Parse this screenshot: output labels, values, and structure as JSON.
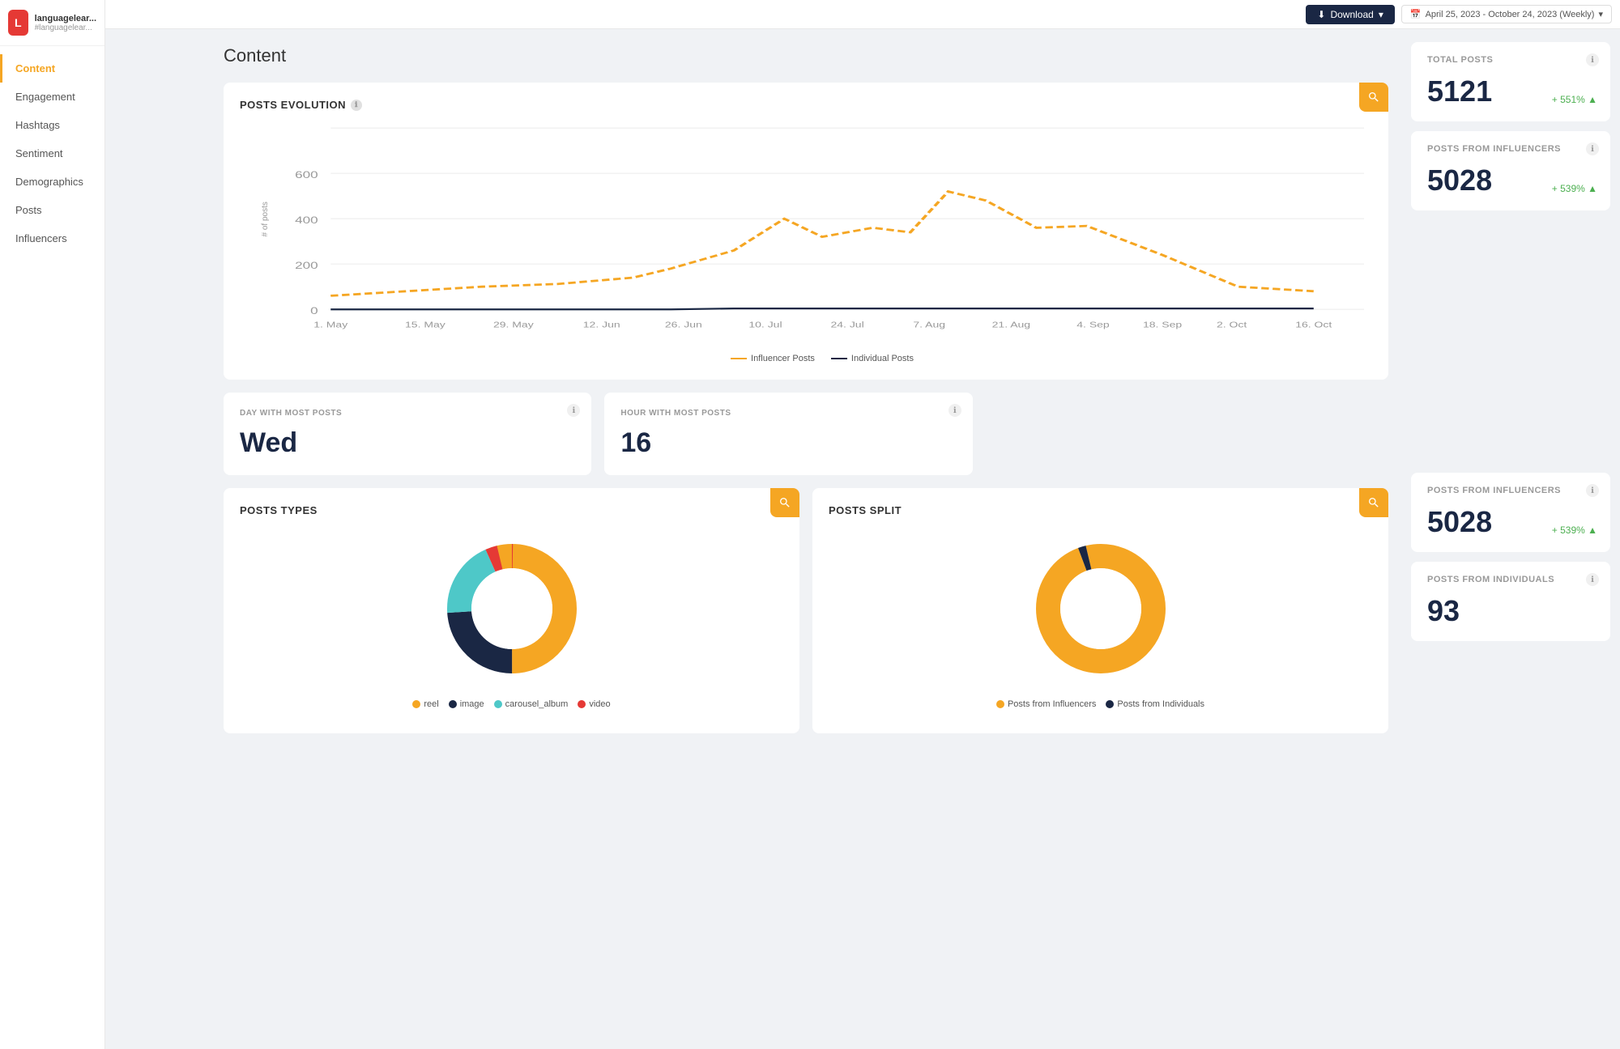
{
  "app": {
    "logo_letter": "L",
    "logo_name": "languagelear...",
    "logo_handle": "#languagelear..."
  },
  "nav": {
    "items": [
      {
        "label": "Content",
        "active": true,
        "id": "content"
      },
      {
        "label": "Engagement",
        "active": false,
        "id": "engagement"
      },
      {
        "label": "Hashtags",
        "active": false,
        "id": "hashtags"
      },
      {
        "label": "Sentiment",
        "active": false,
        "id": "sentiment"
      },
      {
        "label": "Demographics",
        "active": false,
        "id": "demographics"
      },
      {
        "label": "Posts",
        "active": false,
        "id": "posts"
      },
      {
        "label": "Influencers",
        "active": false,
        "id": "influencers"
      }
    ]
  },
  "topbar": {
    "download_label": "Download",
    "date_range": "April 25, 2023 - October 24, 2023 (Weekly)"
  },
  "page": {
    "title": "Content"
  },
  "right_stats": [
    {
      "id": "total-posts",
      "title": "TOTAL POSTS",
      "value": "5121",
      "change": "+ 551%"
    },
    {
      "id": "posts-from-influencers-top",
      "title": "POSTS FROM INFLUENCERS",
      "value": "5028",
      "change": "+ 539%"
    }
  ],
  "right_stats_bottom": [
    {
      "id": "posts-from-influencers-bottom",
      "title": "POSTS FROM INFLUENCERS",
      "value": "5028",
      "change": "+ 539%"
    },
    {
      "id": "posts-from-individuals",
      "title": "POSTS FROM INDIVIDUALS",
      "value": "93",
      "change": ""
    }
  ],
  "posts_evolution": {
    "title": "POSTS EVOLUTION",
    "legend": [
      {
        "label": "Influencer Posts",
        "color": "#f5a623",
        "type": "dashed"
      },
      {
        "label": "Individual Posts",
        "color": "#1a2744",
        "type": "solid"
      }
    ],
    "x_labels": [
      "1. May",
      "15. May",
      "29. May",
      "12. Jun",
      "26. Jun",
      "10. Jul",
      "24. Jul",
      "7. Aug",
      "21. Aug",
      "4. Sep",
      "18. Sep",
      "2. Oct",
      "16. Oct"
    ],
    "y_labels": [
      "0",
      "200",
      "400",
      "600"
    ],
    "influencer_line": [
      60,
      80,
      100,
      120,
      160,
      200,
      240,
      380,
      260,
      300,
      280,
      560,
      480,
      300,
      320,
      180,
      100,
      80
    ],
    "individual_line": [
      5,
      5,
      6,
      5,
      5,
      4,
      5,
      5,
      5,
      5,
      5,
      5,
      5,
      5,
      5,
      5,
      5,
      5
    ]
  },
  "day_most_posts": {
    "title": "DAY WITH MOST POSTS",
    "value": "Wed"
  },
  "hour_most_posts": {
    "title": "HOUR WITH MOST POSTS",
    "value": "16"
  },
  "posts_types": {
    "title": "POSTS TYPES",
    "segments": [
      {
        "label": "reel",
        "color": "#f5a623",
        "percent": 52
      },
      {
        "label": "image",
        "color": "#1a2744",
        "percent": 25
      },
      {
        "label": "carousel_album",
        "color": "#4ec8c8",
        "percent": 20
      },
      {
        "label": "video",
        "color": "#e53935",
        "percent": 3
      }
    ]
  },
  "posts_split": {
    "title": "POSTS SPLIT",
    "segments": [
      {
        "label": "Posts from Influencers",
        "color": "#f5a623",
        "percent": 98
      },
      {
        "label": "Posts from Individuals",
        "color": "#1a2744",
        "percent": 2
      }
    ]
  },
  "icons": {
    "search": "🔍",
    "download": "⬇",
    "calendar": "📅",
    "info": "ℹ",
    "chevron_down": "▾"
  }
}
